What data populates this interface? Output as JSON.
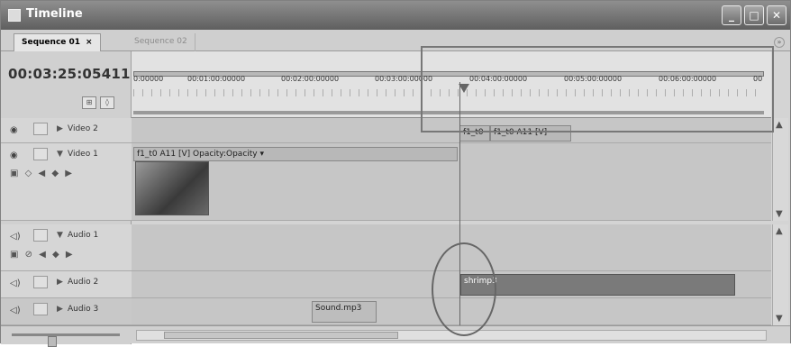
{
  "window": {
    "title": "Timeline"
  },
  "tabs": [
    {
      "label": "Sequence 01",
      "close": "×"
    },
    {
      "label": "Sequence 02"
    }
  ],
  "timecode": "00:03:25:05411",
  "ruler": {
    "labels": [
      "0:00000",
      "00:01:00:00000",
      "00:02:00:00000",
      "00:03:00:00000",
      "00:04:00:00000",
      "00:05:00:00000",
      "00:06:00:00000",
      "00"
    ]
  },
  "tracks": {
    "video2": {
      "name": "Video 2"
    },
    "video1": {
      "name": "Video 1"
    },
    "audio1": {
      "name": "Audio 1"
    },
    "audio2": {
      "name": "Audio 2"
    },
    "audio3": {
      "name": "Audio 3"
    }
  },
  "clips": {
    "video2_a": "f1_t0",
    "video2_b": "f1_t0 A11 [V]",
    "video1": "f1_t0 A11 [V] Opacity:Opacity ▾",
    "audio2": "shrimp3",
    "audio3": "Sound.mp3"
  },
  "icons": {
    "eye": "eye-icon",
    "speaker": "speaker-icon",
    "collapse": "triangle-icon"
  }
}
